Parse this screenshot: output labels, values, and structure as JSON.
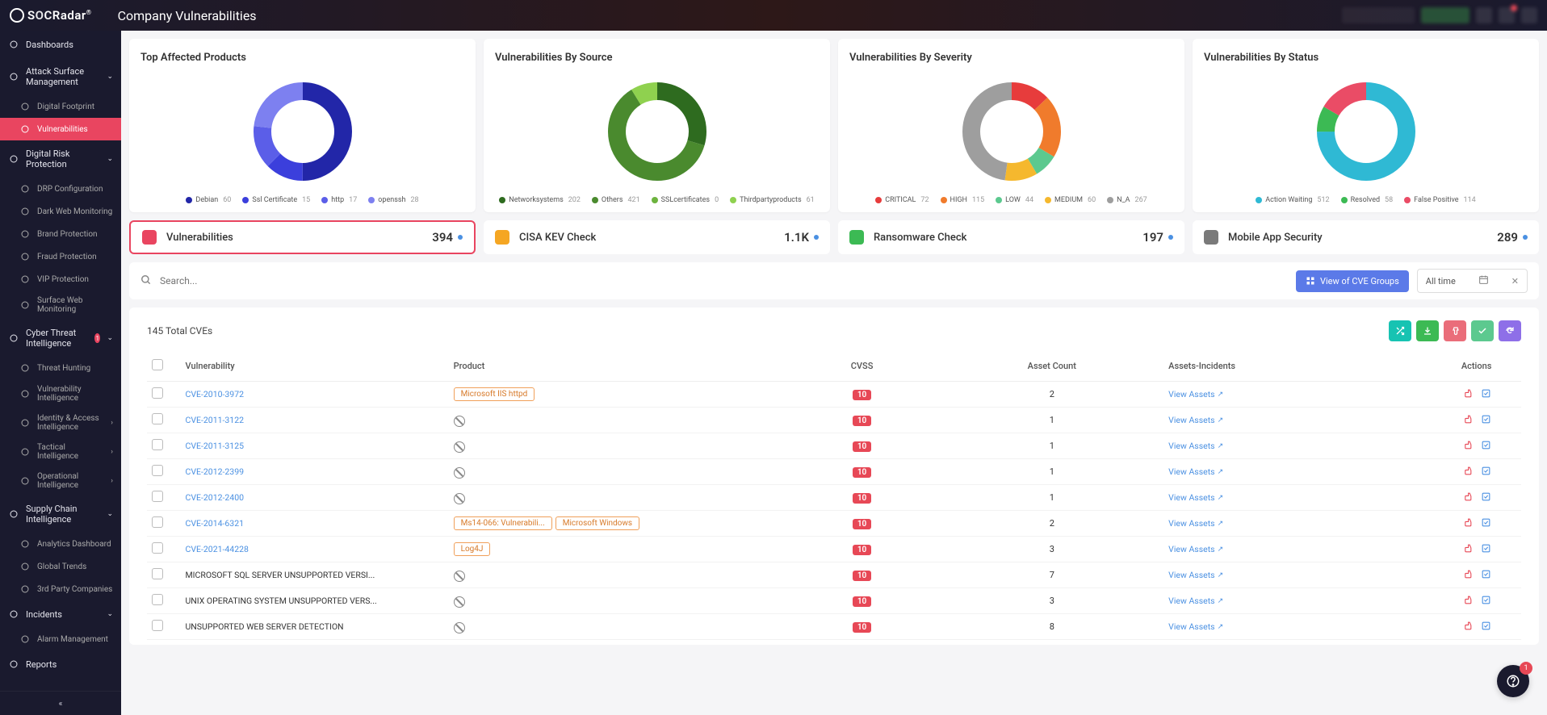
{
  "header": {
    "brand_prefix": "S",
    "brand_mid": "C",
    "brand_name": "SOCRadar",
    "page_title": "Company Vulnerabilities",
    "fab_badge": "1"
  },
  "sidebar": {
    "items": [
      {
        "label": "Dashboards",
        "type": "section",
        "chev": false
      },
      {
        "label": "Attack Surface Management",
        "type": "section",
        "chev": true
      },
      {
        "label": "Digital Footprint",
        "type": "sub"
      },
      {
        "label": "Vulnerabilities",
        "type": "sub",
        "active": true
      },
      {
        "label": "Digital Risk Protection",
        "type": "section",
        "chev": true
      },
      {
        "label": "DRP Configuration",
        "type": "sub"
      },
      {
        "label": "Dark Web Monitoring",
        "type": "sub"
      },
      {
        "label": "Brand Protection",
        "type": "sub"
      },
      {
        "label": "Fraud Protection",
        "type": "sub"
      },
      {
        "label": "VIP Protection",
        "type": "sub"
      },
      {
        "label": "Surface Web Monitoring",
        "type": "sub"
      },
      {
        "label": "Cyber Threat Intelligence",
        "type": "section",
        "chev": true,
        "badge": "1"
      },
      {
        "label": "Threat Hunting",
        "type": "sub"
      },
      {
        "label": "Vulnerability Intelligence",
        "type": "sub"
      },
      {
        "label": "Identity & Access Intelligence",
        "type": "sub",
        "arrow": true
      },
      {
        "label": "Tactical Intelligence",
        "type": "sub",
        "arrow": true
      },
      {
        "label": "Operational Intelligence",
        "type": "sub",
        "arrow": true
      },
      {
        "label": "Supply Chain Intelligence",
        "type": "section",
        "chev": true
      },
      {
        "label": "Analytics Dashboard",
        "type": "sub"
      },
      {
        "label": "Global Trends",
        "type": "sub"
      },
      {
        "label": "3rd Party Companies",
        "type": "sub"
      },
      {
        "label": "Incidents",
        "type": "section",
        "chev": true
      },
      {
        "label": "Alarm Management",
        "type": "sub"
      },
      {
        "label": "Reports",
        "type": "section",
        "chev": false
      }
    ]
  },
  "chart_data": [
    {
      "type": "pie",
      "title": "Top Affected Products",
      "series": [
        {
          "name": "Debian",
          "value": 60,
          "color": "#2226a8"
        },
        {
          "name": "Ssl Certificate",
          "value": 15,
          "color": "#3b3fdc"
        },
        {
          "name": "http",
          "value": 17,
          "color": "#5b5ee8"
        },
        {
          "name": "openssh",
          "value": 28,
          "color": "#7d80f0"
        }
      ]
    },
    {
      "type": "pie",
      "title": "Vulnerabilities By Source",
      "series": [
        {
          "name": "Networksystems",
          "value": 202,
          "color": "#2e6b1f"
        },
        {
          "name": "Others",
          "value": 421,
          "color": "#4a8a2e"
        },
        {
          "name": "SSLcertificates",
          "value": 0,
          "color": "#6db33f"
        },
        {
          "name": "Thirdpartyproducts",
          "value": 61,
          "color": "#8fd14f"
        }
      ]
    },
    {
      "type": "pie",
      "title": "Vulnerabilities By Severity",
      "series": [
        {
          "name": "CRITICAL",
          "value": 72,
          "color": "#e73c3c"
        },
        {
          "name": "HIGH",
          "value": 115,
          "color": "#f07b2c"
        },
        {
          "name": "LOW",
          "value": 44,
          "color": "#5cc98f"
        },
        {
          "name": "MEDIUM",
          "value": 60,
          "color": "#f5b82e"
        },
        {
          "name": "N_A",
          "value": 267,
          "color": "#9e9e9e"
        }
      ]
    },
    {
      "type": "pie",
      "title": "Vulnerabilities By Status",
      "series": [
        {
          "name": "Action Waiting",
          "value": 512,
          "color": "#2fb9d4"
        },
        {
          "name": "Resolved",
          "value": 58,
          "color": "#3cba54"
        },
        {
          "name": "False Positive",
          "value": 114,
          "color": "#ea4c66"
        }
      ]
    }
  ],
  "stats": [
    {
      "label": "Vulnerabilities",
      "value": "394",
      "color": "#e94560",
      "selected": true
    },
    {
      "label": "CISA KEV Check",
      "value": "1.1K",
      "color": "#f5a623",
      "selected": false
    },
    {
      "label": "Ransomware Check",
      "value": "197",
      "color": "#3cba54",
      "selected": false
    },
    {
      "label": "Mobile App Security",
      "value": "289",
      "color": "#7a7a7a",
      "selected": false
    }
  ],
  "search": {
    "placeholder": "Search...",
    "view_btn": "View of CVE Groups",
    "time_filter": "All time"
  },
  "table": {
    "total_label": "145 Total CVEs",
    "cols": {
      "vuln": "Vulnerability",
      "product": "Product",
      "cvss": "CVSS",
      "asset_count": "Asset Count",
      "assets_incidents": "Assets-Incidents",
      "actions": "Actions"
    },
    "view_assets_label": "View Assets",
    "rows": [
      {
        "cve": "CVE-2010-3972",
        "link": true,
        "products": [
          "Microsoft IIS httpd"
        ],
        "cvss": "10",
        "asset_count": "2"
      },
      {
        "cve": "CVE-2011-3122",
        "link": true,
        "products": [],
        "cvss": "10",
        "asset_count": "1"
      },
      {
        "cve": "CVE-2011-3125",
        "link": true,
        "products": [],
        "cvss": "10",
        "asset_count": "1"
      },
      {
        "cve": "CVE-2012-2399",
        "link": true,
        "products": [],
        "cvss": "10",
        "asset_count": "1"
      },
      {
        "cve": "CVE-2012-2400",
        "link": true,
        "products": [],
        "cvss": "10",
        "asset_count": "1"
      },
      {
        "cve": "CVE-2014-6321",
        "link": true,
        "products": [
          "Ms14-066: Vulnerabili...",
          "Microsoft Windows"
        ],
        "cvss": "10",
        "asset_count": "2"
      },
      {
        "cve": "CVE-2021-44228",
        "link": true,
        "products": [
          "Log4J"
        ],
        "cvss": "10",
        "asset_count": "3"
      },
      {
        "cve": "MICROSOFT SQL SERVER UNSUPPORTED VERSI...",
        "link": false,
        "products": [],
        "cvss": "10",
        "asset_count": "7"
      },
      {
        "cve": "UNIX OPERATING SYSTEM UNSUPPORTED VERS...",
        "link": false,
        "products": [],
        "cvss": "10",
        "asset_count": "3"
      },
      {
        "cve": "UNSUPPORTED WEB SERVER DETECTION",
        "link": false,
        "products": [],
        "cvss": "10",
        "asset_count": "8"
      }
    ]
  }
}
